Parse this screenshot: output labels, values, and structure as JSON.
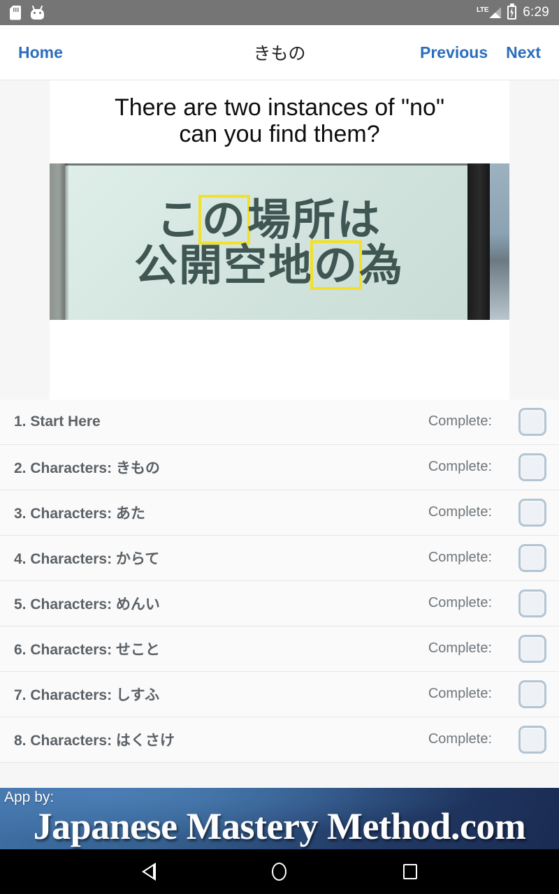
{
  "status_bar": {
    "time": "6:29",
    "network": "LTE",
    "icons": [
      "sd-card-icon",
      "android-bug-icon",
      "signal-icon",
      "battery-charging-icon"
    ]
  },
  "appbar": {
    "home_label": "Home",
    "title": "きもの",
    "previous_label": "Previous",
    "next_label": "Next",
    "link_color": "#2a6ebb"
  },
  "lesson": {
    "prompt_line1": "There are two instances of \"no\"",
    "prompt_line2": "can you find them?",
    "sign_photo": {
      "alt_name": "japanese-street-sign-photo",
      "line1_pre": "こ",
      "line1_highlight": "の",
      "line1_post": "場所は",
      "line2_pre": "公開空地",
      "line2_highlight": "の",
      "line2_post": "為",
      "full_text": "この場所は公開空地の為",
      "highlight_color": "#f3e028"
    }
  },
  "list": {
    "complete_label": "Complete:",
    "rows": [
      {
        "title": "1. Start Here",
        "complete": "Complete:",
        "checked": false
      },
      {
        "title": "2. Characters: きもの",
        "complete": "Complete:",
        "checked": false
      },
      {
        "title": "3. Characters: あた",
        "complete": "Complete:",
        "checked": false
      },
      {
        "title": "4. Characters: からて",
        "complete": "Complete:",
        "checked": false
      },
      {
        "title": "5. Characters: めんい",
        "complete": "Complete:",
        "checked": false
      },
      {
        "title": "6. Characters: せこと",
        "complete": "Complete:",
        "checked": false
      },
      {
        "title": "7. Characters: しすふ",
        "complete": "Complete:",
        "checked": false
      },
      {
        "title": "8. Characters: はくさけ",
        "complete": "Complete:",
        "checked": false
      }
    ]
  },
  "promo": {
    "app_by": "App by:",
    "brand": "Japanese Mastery Method.com",
    "gradient_from": "#3f6fa5",
    "gradient_to": "#1a2b52"
  },
  "system_nav": {
    "back": "back-button",
    "home": "home-button",
    "recents": "recents-button"
  }
}
